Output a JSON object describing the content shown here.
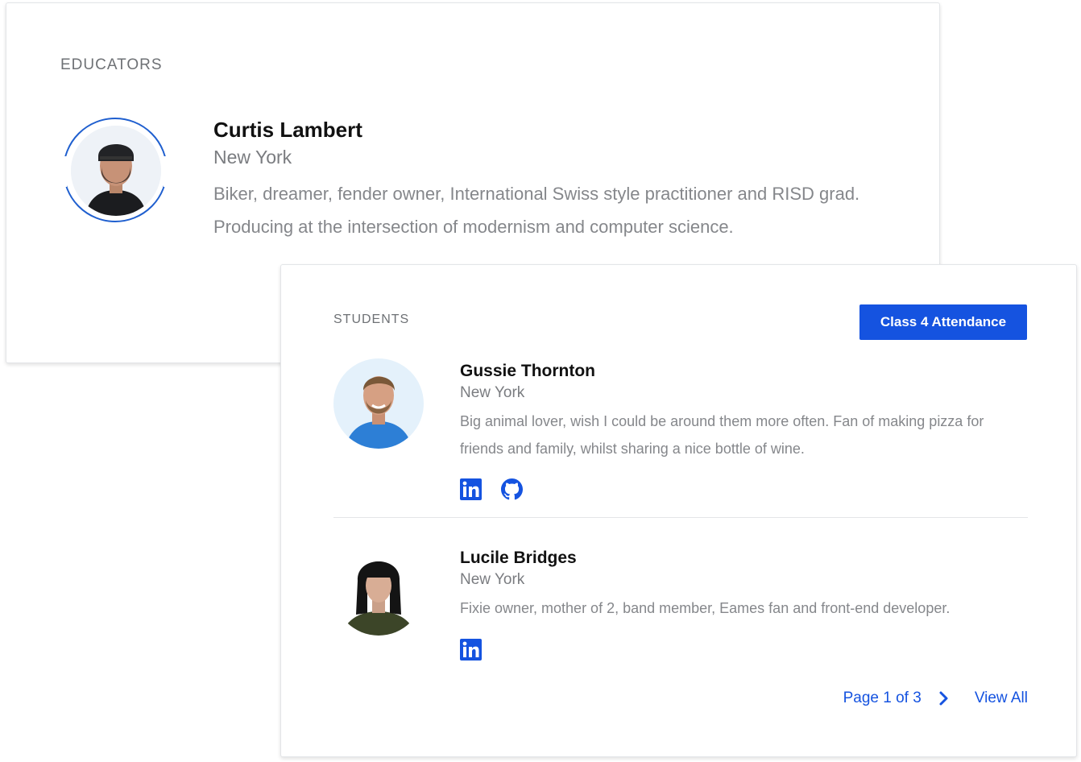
{
  "educators": {
    "title": "EDUCATORS",
    "person": {
      "name": "Curtis Lambert",
      "city": "New York",
      "bio": "Biker, dreamer, fender owner, International Swiss style practitioner and RISD grad. Producing at the intersection of modernism and computer science.",
      "avatar_icon": "avatar-photo"
    }
  },
  "students": {
    "title": "STUDENTS",
    "attendance_button": "Class 4 Attendance",
    "list": [
      {
        "name": "Gussie Thornton",
        "city": "New York",
        "bio": "Big animal lover, wish I could be around them more often. Fan of making pizza for friends and family, whilst sharing a nice bottle of wine.",
        "social": [
          "linkedin-icon",
          "github-icon"
        ]
      },
      {
        "name": "Lucile Bridges",
        "city": "New York",
        "bio": "Fixie owner, mother of 2, band member, Eames fan and front-end developer.",
        "social": [
          "linkedin-icon"
        ]
      }
    ],
    "pagination": {
      "label": "Page 1 of 3",
      "view_all": "View All"
    }
  },
  "colors": {
    "accent": "#1553e0",
    "ring": "#1f5fcf"
  }
}
